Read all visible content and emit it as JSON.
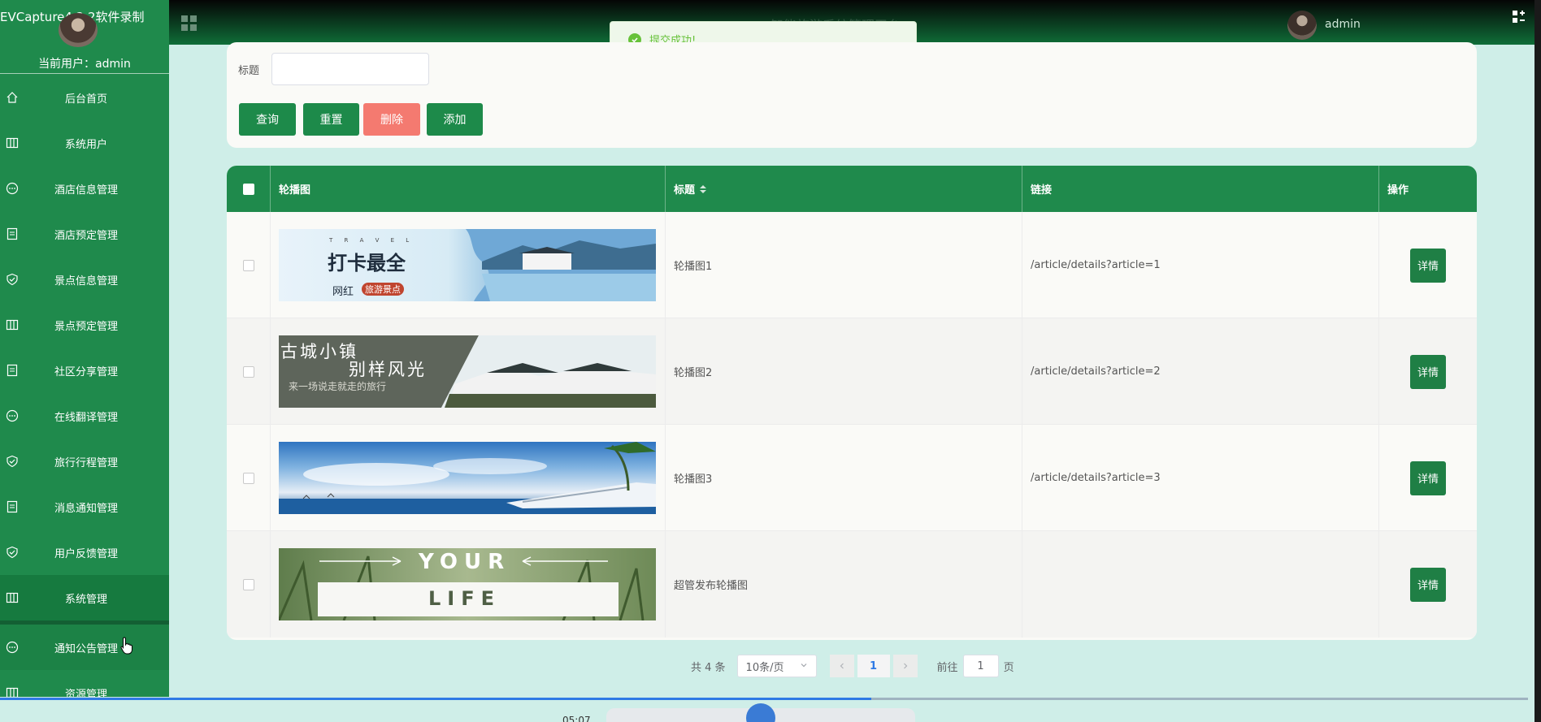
{
  "recorder": {
    "title": "EVCapture4.2.2软件录制",
    "time": "05:07"
  },
  "sidebar": {
    "current_user_label": "当前用户：",
    "current_user": "admin",
    "items": [
      {
        "label": "后台首页",
        "icon": "home-icon"
      },
      {
        "label": "系统用户",
        "icon": "columns-icon"
      },
      {
        "label": "酒店信息管理",
        "icon": "chat-icon"
      },
      {
        "label": "酒店预定管理",
        "icon": "document-icon"
      },
      {
        "label": "景点信息管理",
        "icon": "shield-icon"
      },
      {
        "label": "景点预定管理",
        "icon": "columns-icon"
      },
      {
        "label": "社区分享管理",
        "icon": "document-icon"
      },
      {
        "label": "在线翻译管理",
        "icon": "chat-icon"
      },
      {
        "label": "旅行行程管理",
        "icon": "shield-icon"
      },
      {
        "label": "消息通知管理",
        "icon": "document-icon"
      },
      {
        "label": "用户反馈管理",
        "icon": "shield-icon"
      },
      {
        "label": "系统管理",
        "icon": "columns-icon"
      },
      {
        "label": "通知公告管理",
        "icon": "chat-icon"
      },
      {
        "label": "资源管理",
        "icon": "columns-icon"
      }
    ]
  },
  "header": {
    "title": "智能旅游系统管理平台",
    "admin_name": "admin"
  },
  "toast": {
    "message": "提交成功!"
  },
  "search": {
    "title_label": "标题",
    "title_value": "",
    "buttons": {
      "query": "查询",
      "reset": "重置",
      "delete": "删除",
      "add": "添加"
    }
  },
  "table": {
    "columns": {
      "image": "轮播图",
      "title": "标题",
      "link": "链接",
      "actions": "操作"
    },
    "rows": [
      {
        "title": "轮播图1",
        "link": "/article/details?article=1",
        "action": "详情",
        "banner": {
          "line1": "打卡最全",
          "line2": "网红",
          "line3": "旅游景点",
          "small": "T R A V E L"
        }
      },
      {
        "title": "轮播图2",
        "link": "/article/details?article=2",
        "action": "详情",
        "banner": {
          "line1": "古城小镇",
          "line2": "别样风光",
          "line3": "来一场说走就走的旅行"
        }
      },
      {
        "title": "轮播图3",
        "link": "/article/details?article=3",
        "action": "详情",
        "banner": {}
      },
      {
        "title": "超管发布轮播图",
        "link": "",
        "action": "详情",
        "banner": {
          "line1": "YOUR",
          "line2": "LIFE"
        }
      }
    ]
  },
  "pagination": {
    "total": "共 4 条",
    "page_size": "10条/页",
    "current_page": "1",
    "goto_label": "前往",
    "goto_value": "1",
    "goto_suffix": "页"
  },
  "colors": {
    "primary": "#1f8a4c",
    "danger": "#f47a70",
    "success": "#67c23a",
    "bg": "#cfeee8"
  },
  "video": {
    "progress": 0.57
  }
}
